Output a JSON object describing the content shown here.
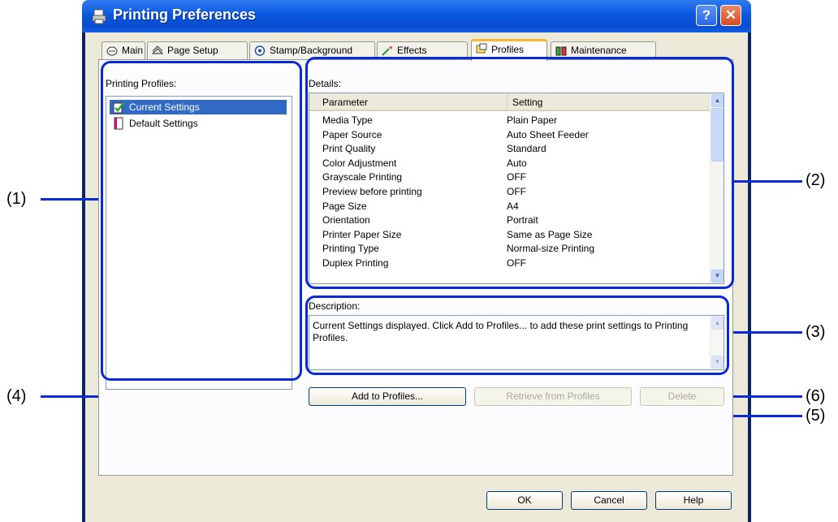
{
  "window": {
    "title": "Printing Preferences"
  },
  "tabs": [
    {
      "label": "Main",
      "icon": "main-icon"
    },
    {
      "label": "Page Setup",
      "icon": "page-setup-icon"
    },
    {
      "label": "Stamp/Background",
      "icon": "stamp-icon"
    },
    {
      "label": "Effects",
      "icon": "effects-icon"
    },
    {
      "label": "Profiles",
      "icon": "profiles-icon",
      "active": true
    },
    {
      "label": "Maintenance",
      "icon": "maintenance-icon"
    }
  ],
  "profiles": {
    "label": "Printing Profiles:",
    "items": [
      {
        "label": "Current Settings",
        "selected": true
      },
      {
        "label": "Default Settings",
        "selected": false
      }
    ]
  },
  "details": {
    "label": "Details:",
    "columns": [
      "Parameter",
      "Setting"
    ],
    "rows": [
      [
        "Media Type",
        "Plain Paper"
      ],
      [
        "Paper Source",
        "Auto Sheet Feeder"
      ],
      [
        "Print Quality",
        "Standard"
      ],
      [
        "Color Adjustment",
        "Auto"
      ],
      [
        "Grayscale Printing",
        "OFF"
      ],
      [
        "Preview before printing",
        "OFF"
      ],
      [
        "Page Size",
        "A4"
      ],
      [
        "Orientation",
        "Portrait"
      ],
      [
        "Printer Paper Size",
        "Same as Page Size"
      ],
      [
        "Printing Type",
        "Normal-size Printing"
      ],
      [
        "Duplex Printing",
        "OFF"
      ]
    ]
  },
  "description": {
    "label": "Description:",
    "text": "Current Settings displayed. Click Add to Profiles... to add these print settings to Printing Profiles."
  },
  "buttons": {
    "add": "Add to Profiles...",
    "retrieve": "Retrieve from Profiles",
    "delete": "Delete",
    "ok": "OK",
    "cancel": "Cancel",
    "help": "Help"
  },
  "callouts": [
    "(1)",
    "(2)",
    "(3)",
    "(4)",
    "(5)",
    "(6)"
  ],
  "colors": {
    "callout": "#0a2ad8",
    "selection": "#316ac5",
    "titlebar": "#0a58e0"
  }
}
